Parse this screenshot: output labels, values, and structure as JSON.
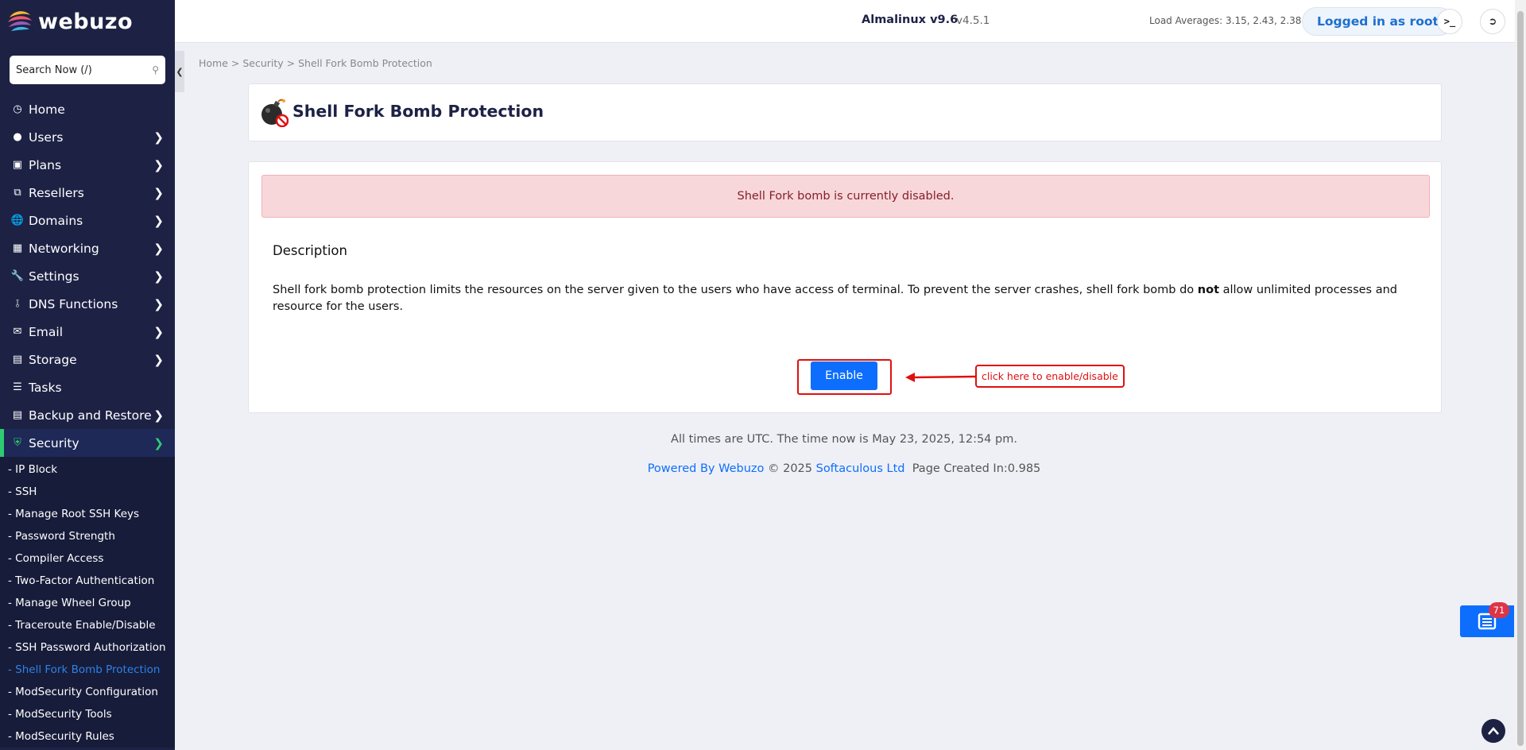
{
  "app": {
    "logo_text": "webuzo"
  },
  "search": {
    "placeholder": "Search Now (/)"
  },
  "sidebar": {
    "items": [
      {
        "label": "Home",
        "icon": "dashboard-icon",
        "has_children": false
      },
      {
        "label": "Users",
        "icon": "user-icon",
        "has_children": true
      },
      {
        "label": "Plans",
        "icon": "plans-icon",
        "has_children": true
      },
      {
        "label": "Resellers",
        "icon": "resellers-icon",
        "has_children": true
      },
      {
        "label": "Domains",
        "icon": "globe-icon",
        "has_children": true
      },
      {
        "label": "Networking",
        "icon": "network-icon",
        "has_children": true
      },
      {
        "label": "Settings",
        "icon": "wrench-icon",
        "has_children": true
      },
      {
        "label": "DNS Functions",
        "icon": "dns-icon",
        "has_children": true
      },
      {
        "label": "Email",
        "icon": "envelope-icon",
        "has_children": true
      },
      {
        "label": "Storage",
        "icon": "storage-icon",
        "has_children": true
      },
      {
        "label": "Tasks",
        "icon": "tasks-icon",
        "has_children": false
      },
      {
        "label": "Backup and Restore",
        "icon": "backup-icon",
        "has_children": true
      },
      {
        "label": "Security",
        "icon": "shield-icon",
        "has_children": true,
        "active": true
      }
    ],
    "security_sub": [
      "- IP Block",
      "- SSH",
      "- Manage Root SSH Keys",
      "- Password Strength",
      "- Compiler Access",
      "- Two-Factor Authentication",
      "- Manage Wheel Group",
      "- Traceroute Enable/Disable",
      "- SSH Password Authorization",
      "- Shell Fork Bomb Protection",
      "- ModSecurity Configuration",
      "- ModSecurity Tools",
      "- ModSecurity Rules"
    ],
    "current_sub_index": 9
  },
  "header": {
    "os_name": "Almalinux v9.6",
    "version": "v4.5.1",
    "load_averages": "Load Averages: 3.15, 2.43, 2.38",
    "logged_in": "Logged in as root",
    "terminal_icon": "terminal-icon",
    "logout_icon": "logout-icon"
  },
  "breadcrumb": "Home > Security > Shell Fork Bomb Protection",
  "page": {
    "title": "Shell Fork Bomb Protection",
    "alert": "Shell Fork bomb is currently disabled.",
    "description_heading": "Description",
    "description_before": "Shell fork bomb protection limits the resources on the server given to the users who have access of terminal. To prevent the server crashes, shell fork bomb do ",
    "description_bold": "not",
    "description_after": " allow unlimited processes and resource for the users.",
    "enable_button": "Enable",
    "annotation": "click here to enable/disable"
  },
  "footer": {
    "time_text": "All times are UTC. The time now is May 23, 2025, 12:54 pm.",
    "powered_by": "Powered By Webuzo",
    "copyright": " © 2025 ",
    "company": "Softaculous Ltd",
    "page_created": "  Page Created In:0.985"
  },
  "notifications": {
    "count": "71"
  },
  "colors": {
    "sidebar_bg": "#1d2245",
    "accent": "#0d6efd",
    "active_green": "#2ecc71",
    "danger": "#e01010"
  }
}
